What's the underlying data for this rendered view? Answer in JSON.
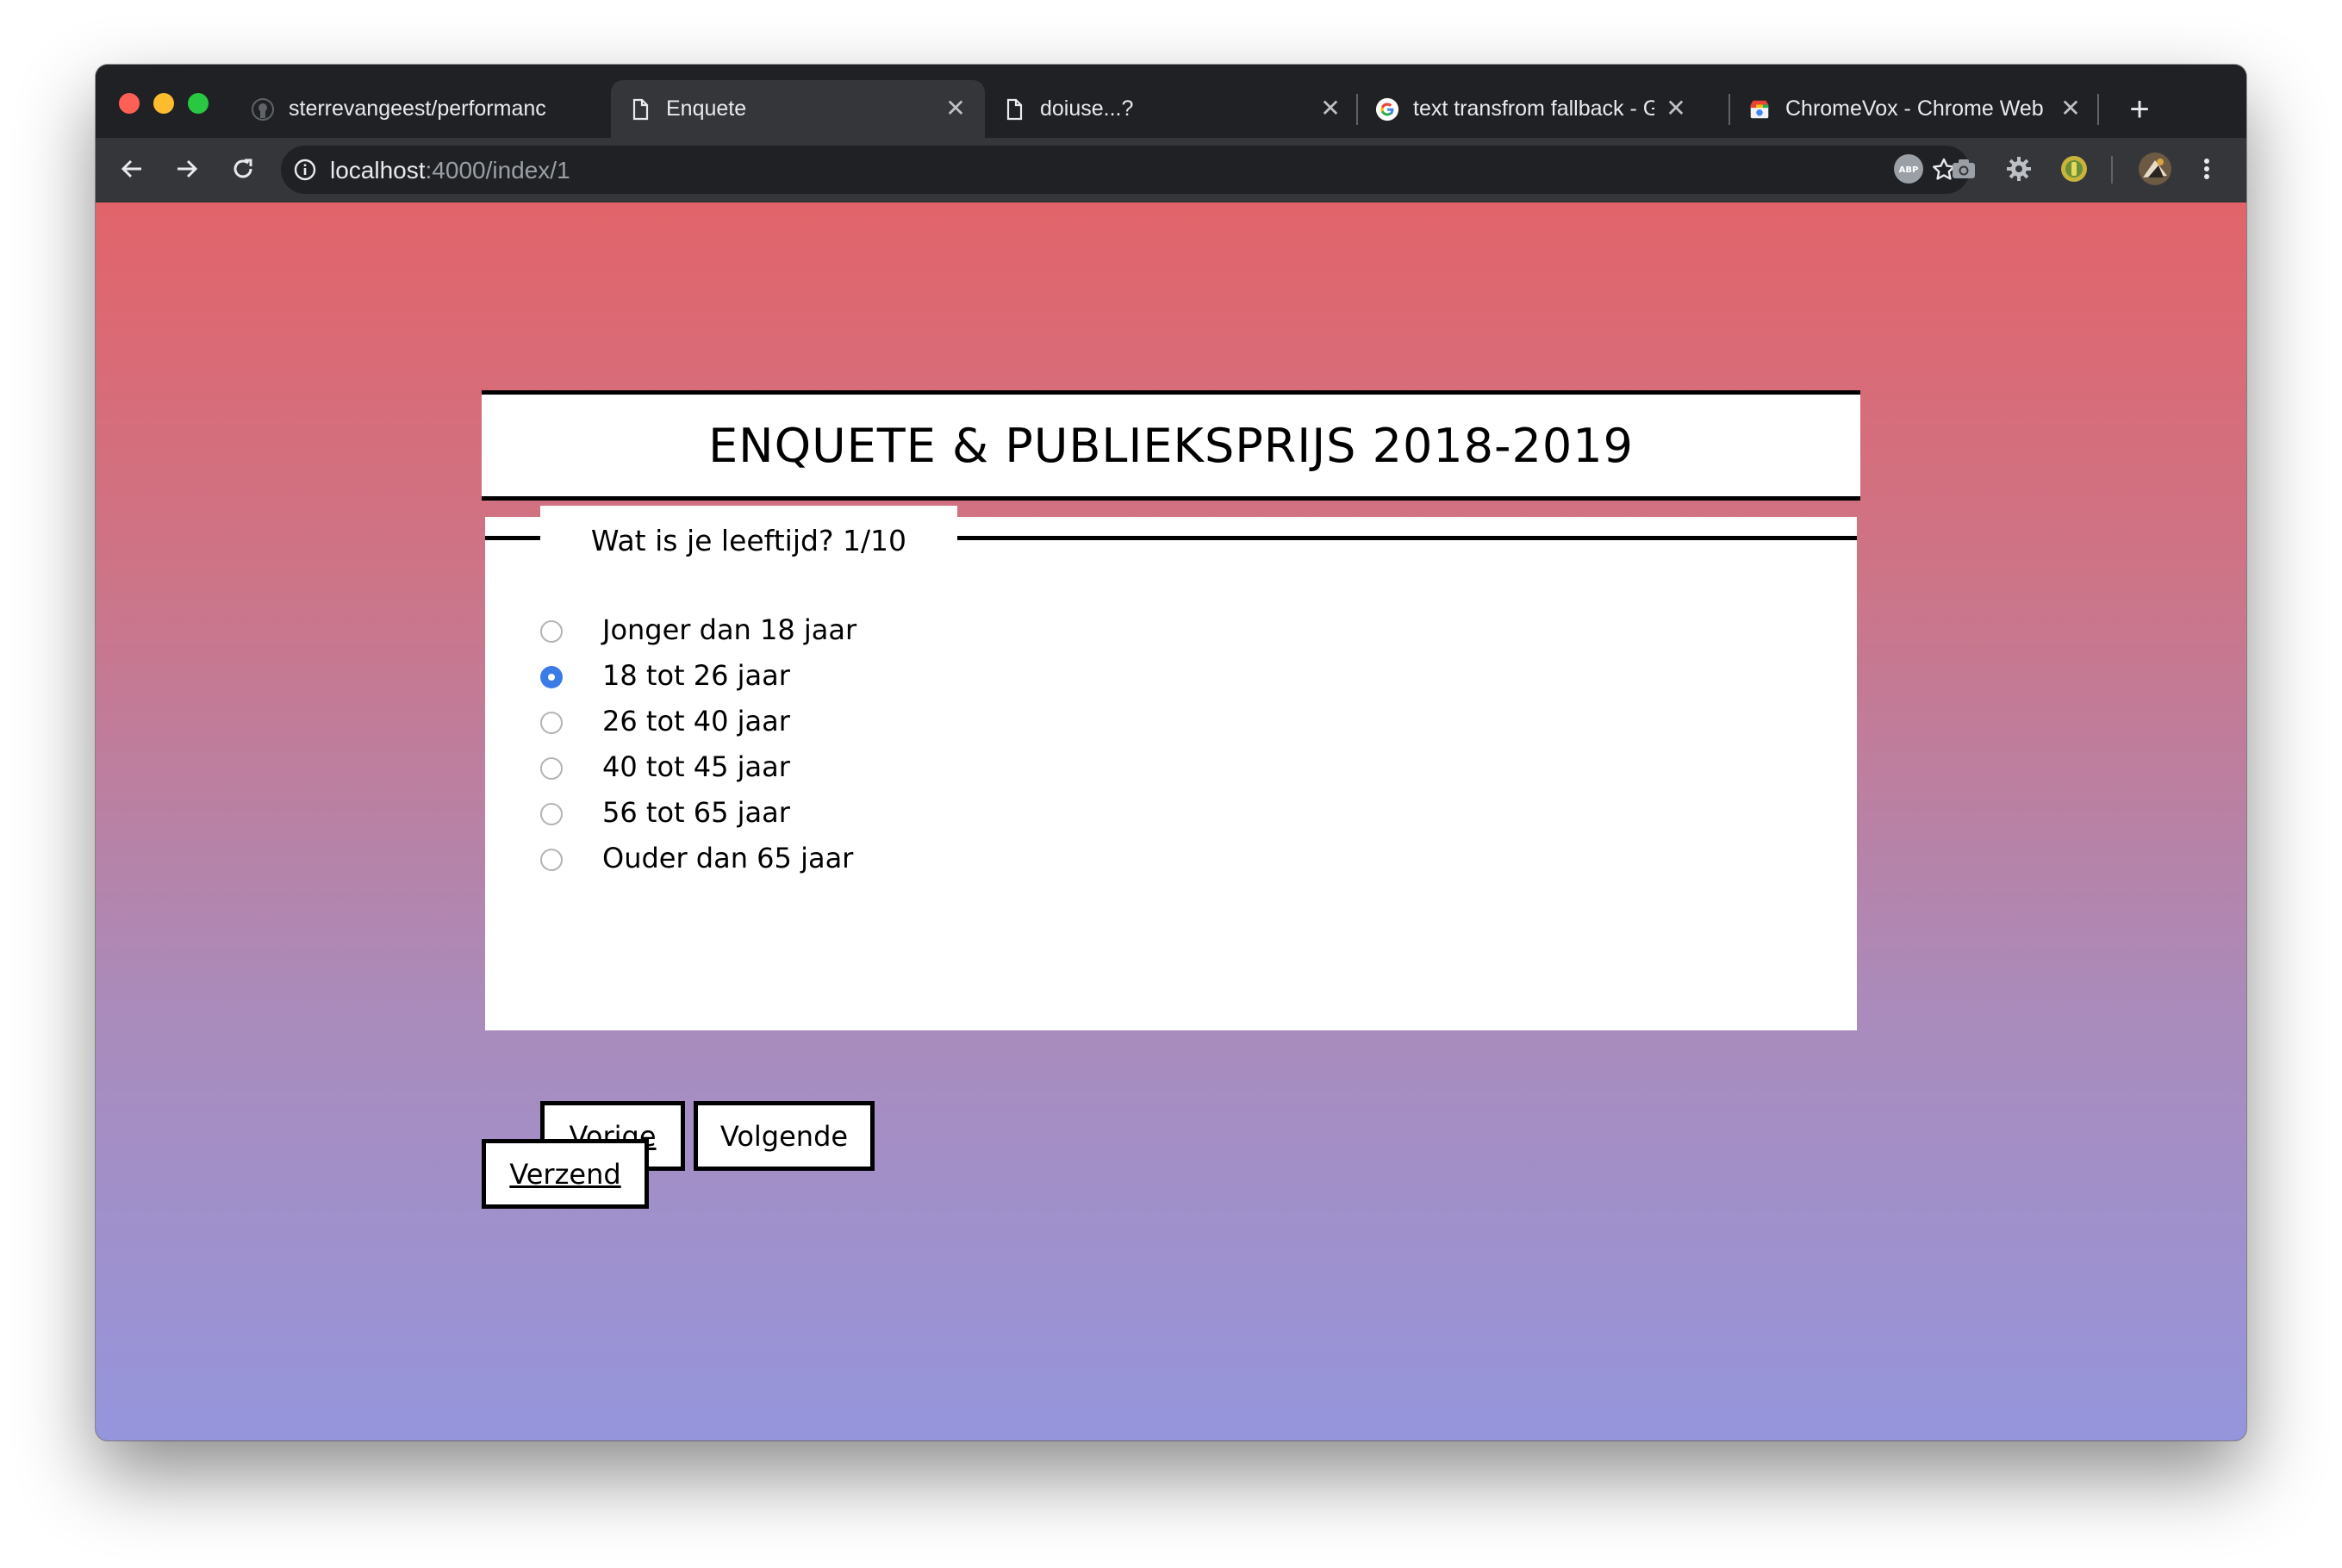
{
  "browser": {
    "tabs": [
      {
        "title": "sterrevangeest/performanc",
        "icon": "github-icon",
        "active": false
      },
      {
        "title": "Enquete",
        "icon": "document-icon",
        "active": true
      },
      {
        "title": "doiuse...?",
        "icon": "document-icon",
        "active": false
      },
      {
        "title": "text transfrom fallback - Go",
        "icon": "google-icon",
        "active": false
      },
      {
        "title": "ChromeVox - Chrome Web",
        "icon": "chrome-web-store-icon",
        "active": false
      }
    ],
    "new_tab_label": "+",
    "close_glyph": "✕",
    "address": {
      "host": "localhost",
      "rest": ":4000/index/1"
    },
    "extensions": [
      "abp-icon",
      "camera-icon",
      "gear-icon",
      "extension-icon",
      "profile-avatar"
    ]
  },
  "page": {
    "title": "ENQUETE & PUBLIEKSPRIJS 2018-2019",
    "question": {
      "legend": "Wat is je leeftijd? 1/10",
      "options": [
        {
          "label": "Jonger dan 18 jaar",
          "checked": false
        },
        {
          "label": "18 tot 26 jaar",
          "checked": true
        },
        {
          "label": "26 tot 40 jaar",
          "checked": false
        },
        {
          "label": "40 tot 45 jaar",
          "checked": false
        },
        {
          "label": "56 tot 65 jaar",
          "checked": false
        },
        {
          "label": "Ouder dan 65 jaar",
          "checked": false
        }
      ],
      "prev_label": "Vorige",
      "next_label": "Volgende"
    },
    "submit_label": "Verzend"
  },
  "colors": {
    "gradient_top": "#e2646a",
    "gradient_bottom": "#9595dc",
    "radio_checked": "#3b7be8"
  }
}
